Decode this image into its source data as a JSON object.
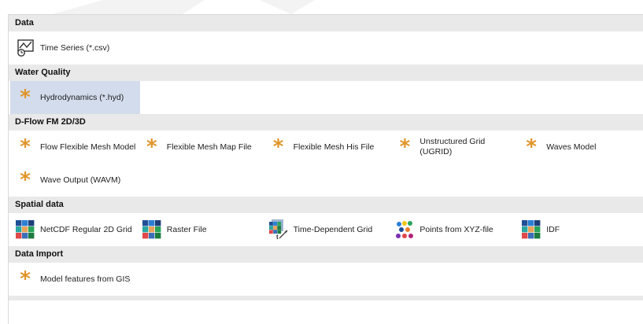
{
  "sections": [
    {
      "title": "Data",
      "rows": [
        [
          {
            "label": "Time Series (*.csv)",
            "icon": "time-series-icon"
          }
        ]
      ]
    },
    {
      "title": "Water Quality",
      "rows": [
        [
          {
            "label": "Hydrodynamics (*.hyd)",
            "icon": "star-icon",
            "selected": true
          }
        ]
      ]
    },
    {
      "title": "D-Flow FM 2D/3D",
      "rows": [
        [
          {
            "label": "Flow Flexible Mesh Model",
            "icon": "star-icon"
          },
          {
            "label": "Flexible Mesh Map File",
            "icon": "star-icon"
          },
          {
            "label": "Flexible Mesh His File",
            "icon": "star-icon"
          },
          {
            "label": "Unstructured Grid (UGRID)",
            "icon": "star-icon"
          },
          {
            "label": "Waves Model",
            "icon": "star-icon"
          }
        ],
        [
          {
            "label": "Wave Output (WAVM)",
            "icon": "star-icon"
          }
        ]
      ]
    },
    {
      "title": "Spatial data",
      "rows": [
        [
          {
            "label": "NetCDF Regular 2D Grid",
            "icon": "grid-icon"
          },
          {
            "label": "Raster File",
            "icon": "grid-icon"
          },
          {
            "label": "Time-Dependent Grid",
            "icon": "time-grid-icon"
          },
          {
            "label": "Points from XYZ-file",
            "icon": "points-icon"
          },
          {
            "label": "IDF",
            "icon": "grid-icon"
          }
        ]
      ]
    },
    {
      "title": "Data Import",
      "rows": [
        [
          {
            "label": "Model features from GIS",
            "icon": "star-icon"
          }
        ]
      ]
    }
  ],
  "colors": {
    "star": "#e0952a",
    "header_bg": "#e9e9e9",
    "selected_bg": "#d3dcec"
  }
}
